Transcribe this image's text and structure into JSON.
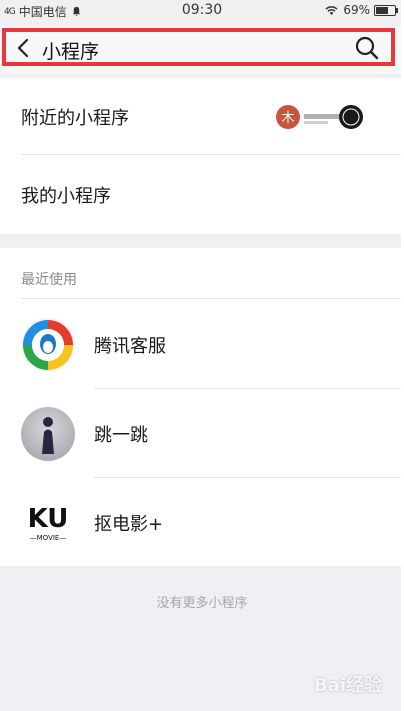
{
  "status_bar": {
    "signal": "4G",
    "carrier": "中国电信",
    "time": "09:30",
    "battery": "69%",
    "battery_level": 0.69,
    "icons": [
      "signal-icon",
      "notification-bell-icon",
      "wifi-icon",
      "battery-icon"
    ]
  },
  "nav": {
    "title": "小程序",
    "back_icon": "chevron-left-icon",
    "search_icon": "search-icon",
    "highlight_color": "#e8383d"
  },
  "menu": {
    "nearby": "附近的小程序",
    "mine": "我的小程序"
  },
  "recent": {
    "header": "最近使用",
    "apps": [
      {
        "name": "腾讯客服",
        "icon": "tencent-service-logo-icon"
      },
      {
        "name": "跳一跳",
        "icon": "jump-game-avatar-icon"
      },
      {
        "name": "抠电影+",
        "icon": "ku-movie-logo-icon"
      }
    ]
  },
  "ku_logo": {
    "main": "KU",
    "sub": "—MOVIE—"
  },
  "no_more": "没有更多小程序",
  "watermark": "Bai经验"
}
